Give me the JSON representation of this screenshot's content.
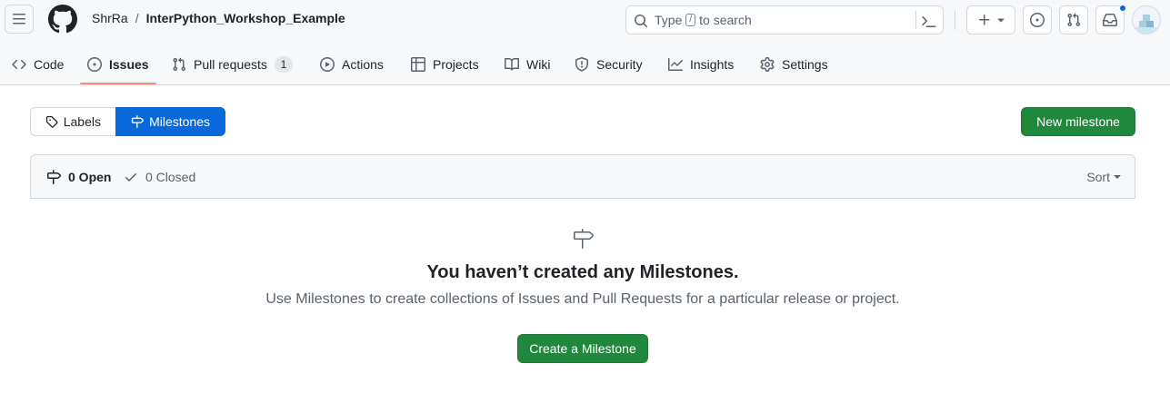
{
  "breadcrumb": {
    "owner": "ShrRa",
    "separator": "/",
    "repo": "InterPython_Workshop_Example"
  },
  "search": {
    "prefix": "Type",
    "shortcut": "/",
    "suffix": "to search"
  },
  "header_icons": [
    "menu-icon",
    "github-logo-icon",
    "search-icon",
    "command-palette-icon",
    "plus-icon",
    "issue-opened-icon",
    "git-pull-request-icon",
    "inbox-icon"
  ],
  "nav": {
    "code": "Code",
    "issues": "Issues",
    "pull_requests": "Pull requests",
    "pull_requests_count": "1",
    "actions": "Actions",
    "projects": "Projects",
    "wiki": "Wiki",
    "security": "Security",
    "insights": "Insights",
    "settings": "Settings"
  },
  "subnav": {
    "labels": "Labels",
    "milestones": "Milestones"
  },
  "new_milestone_button": "New milestone",
  "filters": {
    "open": "0 Open",
    "closed": "0 Closed",
    "sort": "Sort"
  },
  "blankslate": {
    "title": "You haven’t created any Milestones.",
    "description": "Use Milestones to create collections of Issues and Pull Requests for a particular release or project.",
    "button": "Create a Milestone"
  },
  "colors": {
    "primary_green": "#1f883d",
    "accent_blue": "#0969da",
    "nav_underline": "#fd8c73",
    "notification_dot": "#0969da"
  }
}
